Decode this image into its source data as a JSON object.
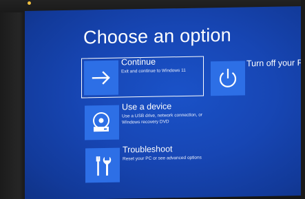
{
  "screen": {
    "title": "Choose an option"
  },
  "options": {
    "continue": {
      "title": "Continue",
      "description": "Exit and continue to Windows 11",
      "icon": "arrow-right-icon"
    },
    "use_device": {
      "title": "Use a device",
      "description": "Use a USB drive, network connection, or Windows recovery DVD",
      "icon": "disc-drive-icon"
    },
    "troubleshoot": {
      "title": "Troubleshoot",
      "description": "Reset your PC or see advanced options",
      "icon": "tools-icon"
    },
    "turn_off": {
      "title": "Turn off your PC",
      "icon": "power-icon"
    }
  },
  "colors": {
    "background": "#1746b4",
    "tile": "#2d6fe6",
    "text": "#ffffff"
  }
}
